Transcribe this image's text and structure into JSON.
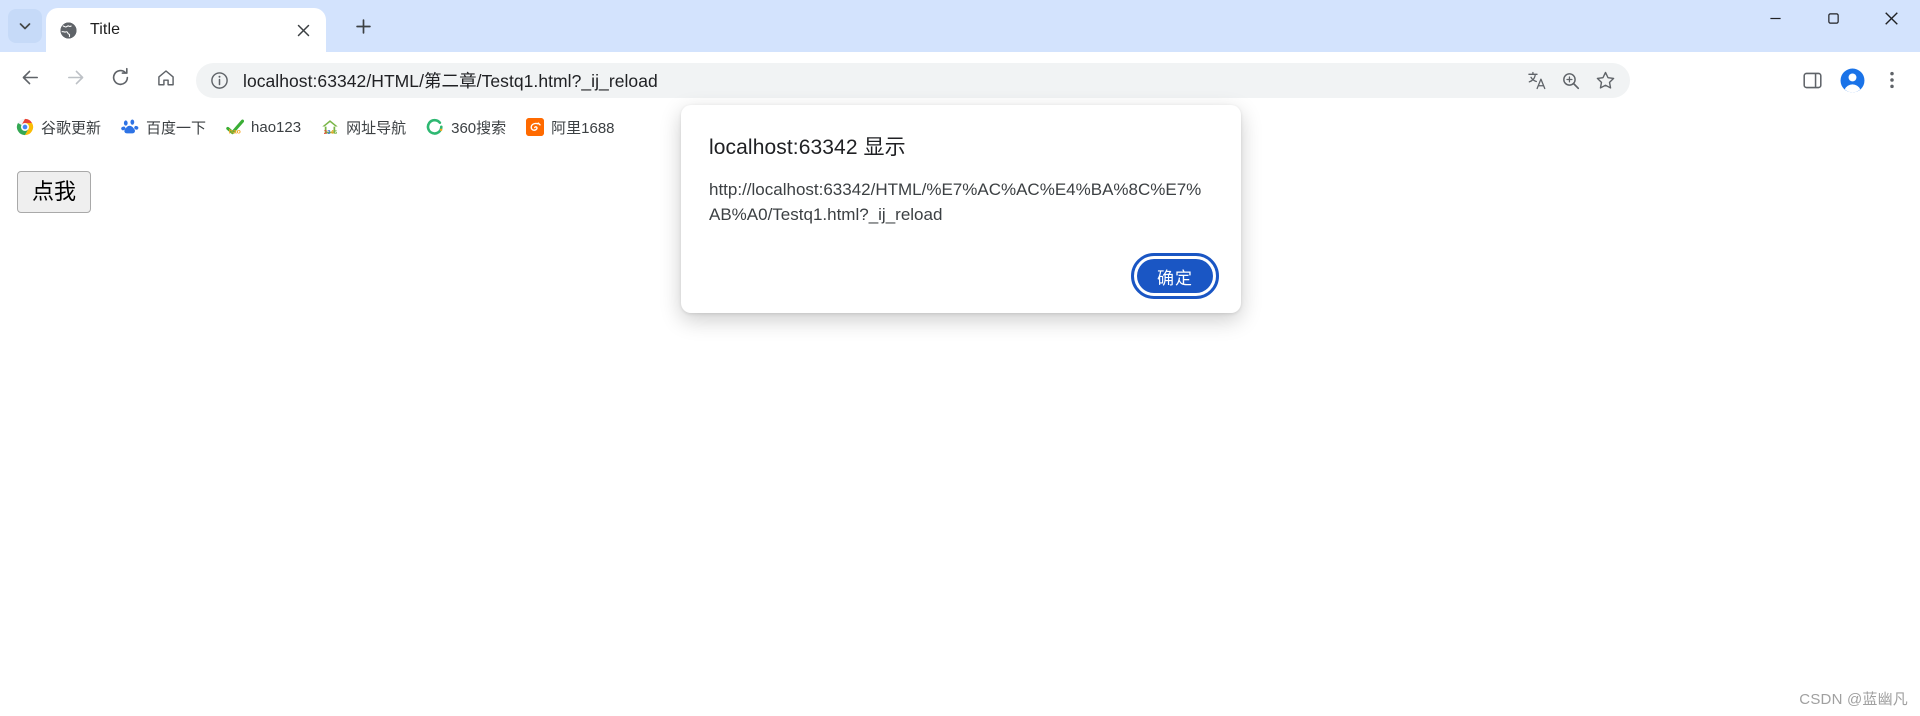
{
  "window": {
    "controls": {
      "minimize": "minimize-icon",
      "maximize": "maximize-icon",
      "close": "close-icon"
    }
  },
  "tabstrip": {
    "tab_search_icon": "chevron-down-icon",
    "new_tab_icon": "plus-icon",
    "tabs": [
      {
        "title": "Title",
        "favicon": "globe-icon",
        "active": true,
        "close_icon": "close-icon"
      }
    ]
  },
  "toolbar": {
    "back_icon": "arrow-left-icon",
    "forward_icon": "arrow-right-icon",
    "reload_icon": "reload-icon",
    "home_icon": "home-icon",
    "omnibox": {
      "site_info_icon": "info-circle-icon",
      "url": "localhost:63342/HTML/第二章/Testq1.html?_ij_reload",
      "translate_icon": "translate-icon",
      "zoom_icon": "zoom-icon",
      "bookmark_icon": "star-icon"
    },
    "side_panel_icon": "side-panel-icon",
    "profile_icon": "avatar-icon",
    "menu_icon": "three-dot-menu-icon"
  },
  "bookmarks": {
    "items": [
      {
        "label": "谷歌更新",
        "icon": "chrome-icon"
      },
      {
        "label": "百度一下",
        "icon": "baidu-icon"
      },
      {
        "label": "hao123",
        "icon": "hao123-icon"
      },
      {
        "label": "网址导航",
        "icon": "2345-icon"
      },
      {
        "label": "360搜索",
        "icon": "360-icon"
      },
      {
        "label": "阿里1688",
        "icon": "alibaba-icon"
      }
    ]
  },
  "page": {
    "button_label": "点我",
    "watermark": "CSDN @蓝幽凡"
  },
  "dialog": {
    "title": "localhost:63342 显示",
    "message": "http://localhost:63342/HTML/%E7%AC%AC%E4%BA%8C%E7%AB%A0/Testq1.html?_ij_reload",
    "ok_label": "确定"
  },
  "colors": {
    "tabstrip_bg": "#d3e3fd",
    "omnibox_bg": "#f1f3f4",
    "dialog_button": "#1a56c4",
    "page_button_bg": "#efefef"
  }
}
